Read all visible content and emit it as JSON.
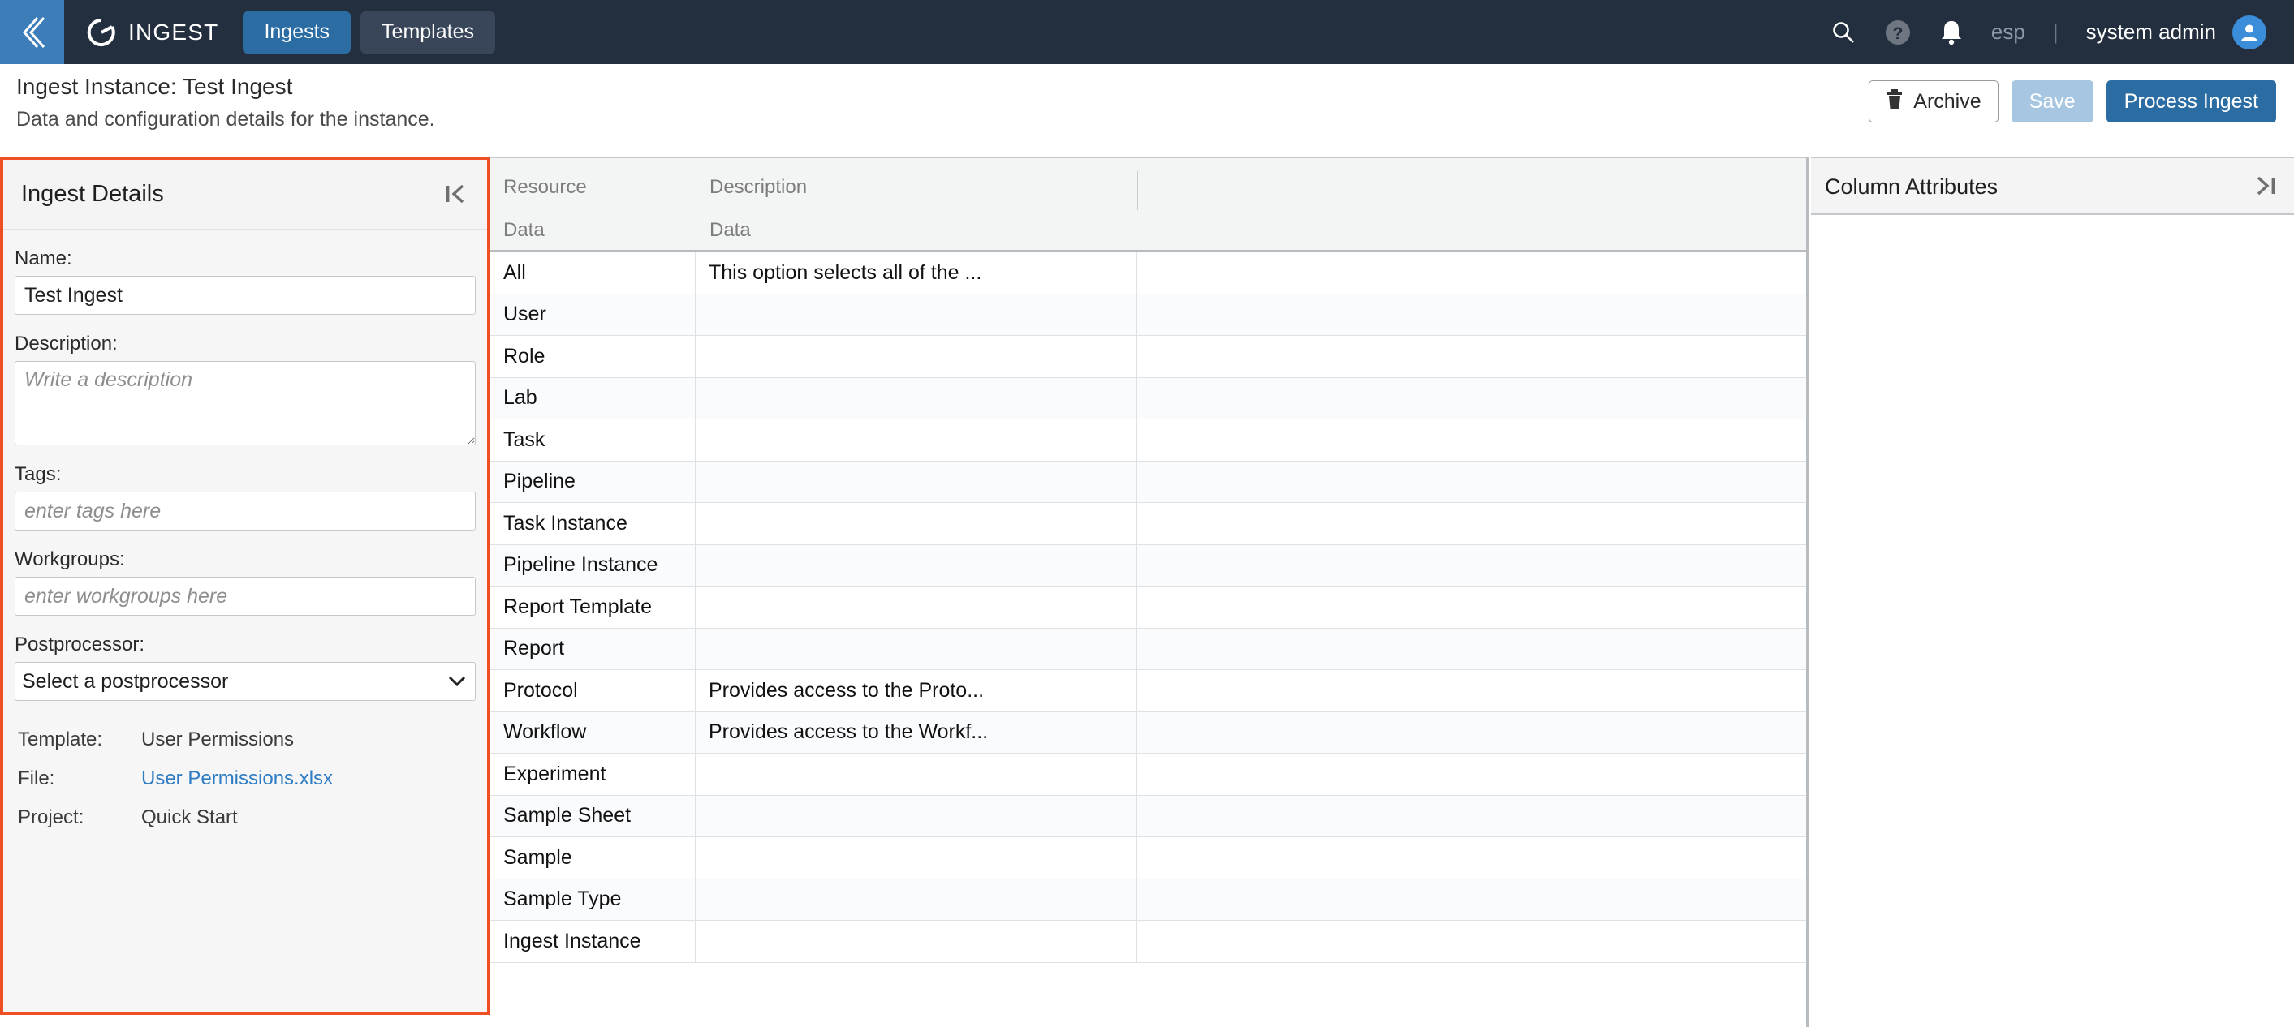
{
  "topnav": {
    "back_icon": "chevron-double-left-icon",
    "brand_icon": "ingest-circle-logo",
    "brand": "INGEST",
    "tabs": [
      {
        "label": "Ingests",
        "active": true
      },
      {
        "label": "Templates",
        "active": false
      }
    ],
    "search_icon": "search-icon",
    "help_icon": "help-icon",
    "notifications_icon": "bell-icon",
    "language": "esp",
    "separator": "|",
    "user": "system admin",
    "avatar_icon": "user-avatar-icon",
    "bg_color": "#232f3e",
    "accent_color": "#2b6ca3"
  },
  "page": {
    "title": "Ingest Instance: Test Ingest",
    "subtitle": "Data and configuration details for the instance.",
    "actions": {
      "archive_label": "Archive",
      "archive_icon": "trash-icon",
      "save_label": "Save",
      "process_label": "Process Ingest"
    }
  },
  "details": {
    "title": "Ingest Details",
    "collapse_icon": "collapse-left-icon",
    "highlight_color": "#f04e23",
    "name_label": "Name:",
    "name_value": "Test Ingest",
    "name_placeholder": "",
    "description_label": "Description:",
    "description_value": "",
    "description_placeholder": "Write a description",
    "tags_label": "Tags:",
    "tags_value": "",
    "tags_placeholder": "enter tags here",
    "workgroups_label": "Workgroups:",
    "workgroups_value": "",
    "workgroups_placeholder": "enter workgroups here",
    "postprocessor_label": "Postprocessor:",
    "postprocessor_value": "Select a postprocessor",
    "postprocessor_options": [
      "Select a postprocessor"
    ],
    "meta": [
      {
        "key": "Template:",
        "value": "User Permissions",
        "is_link": false
      },
      {
        "key": "File:",
        "value": "User Permissions.xlsx",
        "is_link": true
      },
      {
        "key": "Project:",
        "value": "Quick Start",
        "is_link": false
      }
    ]
  },
  "grid": {
    "columns": [
      {
        "title": "Resource",
        "subtitle": "Data"
      },
      {
        "title": "Description",
        "subtitle": "Data"
      }
    ],
    "rows": [
      {
        "resource": "All",
        "description": "This option selects all of the ..."
      },
      {
        "resource": "User",
        "description": ""
      },
      {
        "resource": "Role",
        "description": ""
      },
      {
        "resource": "Lab",
        "description": ""
      },
      {
        "resource": "Task",
        "description": ""
      },
      {
        "resource": "Pipeline",
        "description": ""
      },
      {
        "resource": "Task Instance",
        "description": ""
      },
      {
        "resource": "Pipeline Instance",
        "description": ""
      },
      {
        "resource": "Report Template",
        "description": ""
      },
      {
        "resource": "Report",
        "description": ""
      },
      {
        "resource": "Protocol",
        "description": "Provides access to the Proto..."
      },
      {
        "resource": "Workflow",
        "description": "Provides access to the Workf..."
      },
      {
        "resource": "Experiment",
        "description": ""
      },
      {
        "resource": "Sample Sheet",
        "description": ""
      },
      {
        "resource": "Sample",
        "description": ""
      },
      {
        "resource": "Sample Type",
        "description": ""
      },
      {
        "resource": "Ingest Instance",
        "description": ""
      }
    ]
  },
  "attributes": {
    "title": "Column Attributes",
    "collapse_icon": "collapse-right-icon"
  }
}
